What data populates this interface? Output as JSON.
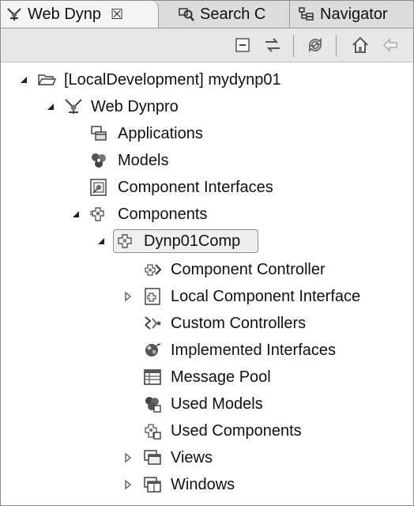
{
  "tabs": [
    {
      "label": "Web Dynp",
      "icon": "web-dynpro-icon",
      "active": true,
      "close": "☒"
    },
    {
      "label": "Search C",
      "icon": "search-icon",
      "active": false
    },
    {
      "label": "Navigator",
      "icon": "navigator-icon",
      "active": false
    }
  ],
  "toolbar": {
    "items": [
      "collapse-all-icon",
      "link-with-editor-icon",
      "sync-icon",
      "home-icon",
      "back-icon"
    ]
  },
  "tree": [
    {
      "label": "[LocalDevelopment] mydynp01",
      "icon": "project-folder-icon",
      "twisty": "expanded"
    },
    {
      "label": "Web Dynpro",
      "icon": "web-dynpro-icon",
      "twisty": "expanded"
    },
    {
      "label": "Applications",
      "icon": "applications-icon",
      "twisty": "none"
    },
    {
      "label": "Models",
      "icon": "models-icon",
      "twisty": "none"
    },
    {
      "label": "Component Interfaces",
      "icon": "component-interfaces-icon",
      "twisty": "none"
    },
    {
      "label": "Components",
      "icon": "components-icon",
      "twisty": "expanded"
    },
    {
      "label": "Dynp01Comp",
      "icon": "component-icon",
      "twisty": "expanded",
      "selected": true
    },
    {
      "label": "Component Controller",
      "icon": "component-controller-icon",
      "twisty": "none"
    },
    {
      "label": "Local Component Interface",
      "icon": "local-component-interface-icon",
      "twisty": "collapsed"
    },
    {
      "label": "Custom Controllers",
      "icon": "custom-controllers-icon",
      "twisty": "none"
    },
    {
      "label": "Implemented Interfaces",
      "icon": "implemented-interfaces-icon",
      "twisty": "none"
    },
    {
      "label": "Message Pool",
      "icon": "message-pool-icon",
      "twisty": "none"
    },
    {
      "label": "Used Models",
      "icon": "used-models-icon",
      "twisty": "none"
    },
    {
      "label": "Used Components",
      "icon": "used-components-icon",
      "twisty": "none"
    },
    {
      "label": "Views",
      "icon": "views-icon",
      "twisty": "collapsed"
    },
    {
      "label": "Windows",
      "icon": "windows-icon",
      "twisty": "collapsed"
    }
  ]
}
